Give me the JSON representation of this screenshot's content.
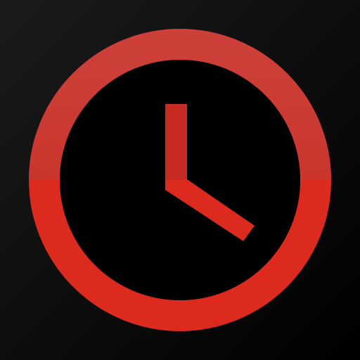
{
  "icon": {
    "name": "clock-icon",
    "colors": {
      "background_top_left": "#1b1b1b",
      "background_bottom_right": "#000000",
      "accent_top": "#c72b23",
      "accent_bottom": "#dc2b1e",
      "accent_highlight": "#d13a2f",
      "face": "#000000"
    }
  }
}
